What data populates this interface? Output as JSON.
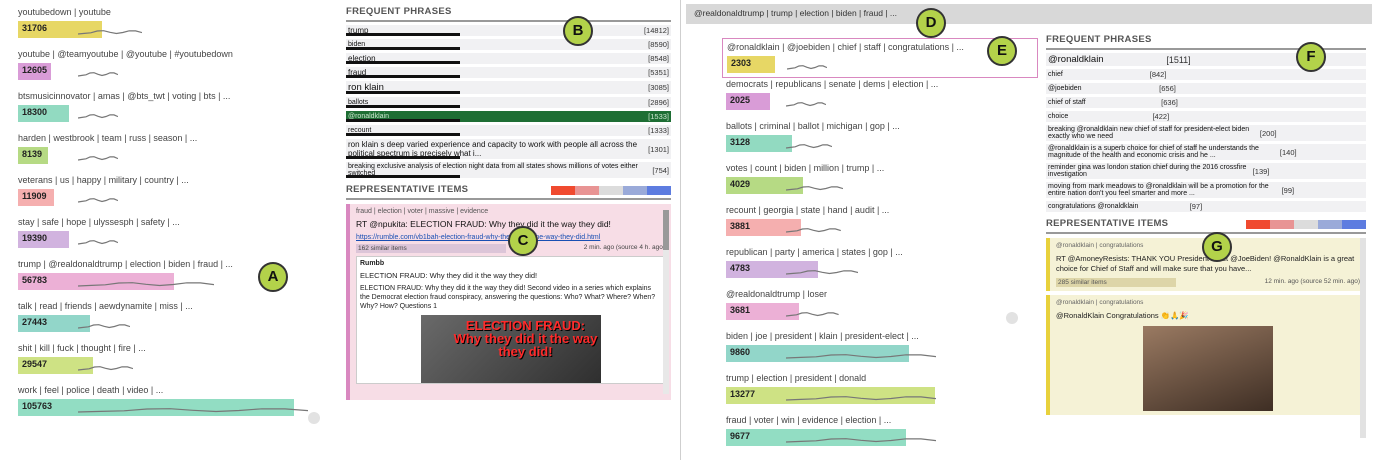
{
  "left_topics": [
    {
      "label": "youtubedown | youtube",
      "count": "31706",
      "color": "#e3d04a",
      "frac": 0.28,
      "spark": [
        0.82,
        1
      ]
    },
    {
      "label": "youtube | @teamyoutube | @youtube | #youtubedown",
      "count": "12605",
      "color": "#d28bd0",
      "frac": 0.11,
      "spark": [
        0.2,
        1
      ]
    },
    {
      "label": "btsmusicinnovator | amas | @bts_twt | voting | bts | ...",
      "count": "18300",
      "color": "#7fd3b6",
      "frac": 0.17,
      "spark": [
        0.3,
        1
      ]
    },
    {
      "label": "harden | westbrook | team | russ | season | ...",
      "count": "8139",
      "color": "#a9d46f",
      "frac": 0.08,
      "spark": [
        0.2,
        1
      ]
    },
    {
      "label": "veterans | us | happy | military | country | ...",
      "count": "11909",
      "color": "#f3a1a1",
      "frac": 0.12,
      "spark": [
        0.15,
        1
      ]
    },
    {
      "label": "stay | safe | hope | ulyssesph | safety | ...",
      "count": "19390",
      "color": "#c9a6d9",
      "frac": 0.17,
      "spark": [
        0.2,
        1
      ]
    },
    {
      "label": "trump | @realdonaldtrump | election | biden | fraud | ...",
      "count": "56783",
      "color": "#e9a2cf",
      "frac": 0.52,
      "spark": [
        0.4,
        1
      ]
    },
    {
      "label": "talk | read | friends | aewdynamite | miss | ...",
      "count": "27443",
      "color": "#7fcfc0",
      "frac": 0.24,
      "spark": [
        0.3,
        1
      ]
    },
    {
      "label": "shit | kill | fuck | thought | fire | ...",
      "count": "29547",
      "color": "#c5dd6e",
      "frac": 0.25,
      "spark": [
        0.75,
        1
      ]
    },
    {
      "label": "work | feel | police | death | video | ...",
      "count": "105763",
      "color": "#7fd7b9",
      "frac": 0.92,
      "spark": [
        0.3,
        1
      ]
    }
  ],
  "col_b": {
    "frequent_title": "FREQUENT PHRASES",
    "phrases": [
      {
        "text": "trump",
        "count": "[14812]",
        "size": "normal"
      },
      {
        "text": "biden",
        "count": "[8590]",
        "size": "small"
      },
      {
        "text": "election",
        "count": "[8548]",
        "size": "normal"
      },
      {
        "text": "fraud",
        "count": "[5351]",
        "size": "normal"
      },
      {
        "text": "ron klain",
        "count": "[3085]",
        "size": "big"
      },
      {
        "text": "ballots",
        "count": "[2896]",
        "size": "small"
      },
      {
        "text": "@ronaldklain",
        "count": "[1533]",
        "size": "small",
        "highlight": true
      },
      {
        "text": "recount",
        "count": "[1333]",
        "size": "small"
      },
      {
        "text": "ron klain s deep varied experience and capacity to work with people all across the political spectrum is precisely what i...",
        "count": "[1301]",
        "size": "normal"
      },
      {
        "text": "breaking exclusive analysis of election night data from all states shows millions of votes either switched",
        "count": "[754]",
        "size": "small"
      }
    ],
    "rep_title": "REPRESENTATIVE ITEMS",
    "item": {
      "tags": "fraud | election | voter | massive | evidence",
      "headline": "RT @npukita: ELECTION FRAUD: Why they did it the way they did!",
      "link": "https://rumble.com/vb1bah-election-fraud-why-they-did-it-the-way-they-did.html",
      "similar": "162 similar items",
      "time": "2 min. ago (source 4 h. ago)",
      "quote_author": "Rumbb",
      "quote_title": "ELECTION FRAUD: Why they did it the way they did!",
      "quote_body": "ELECTION FRAUD: Why they did it the way they did! Second video in a series which explains the Democrat election fraud conspiracy, answering the questions: Who? What? Where? When? Why? How? Questions 1",
      "thumb_text": "ELECTION FRAUD: Why they did it the way they did!"
    }
  },
  "right": {
    "breadcrumb": "@realdonaldtrump | trump | election | biden | fraud | ...",
    "topics": [
      {
        "label": "@ronaldklain | @joebiden | chief | staff | congratulations | ...",
        "count": "2303",
        "color": "#e3d04a",
        "frac": 0.22,
        "selected": true
      },
      {
        "label": "democrats | republicans | senate | dems | election | ...",
        "count": "2025",
        "color": "#d28bd0",
        "frac": 0.2
      },
      {
        "label": "ballots | criminal | ballot | michigan | gop | ...",
        "count": "3128",
        "color": "#7fd3b6",
        "frac": 0.3
      },
      {
        "label": "votes | count | biden | million | trump | ...",
        "count": "4029",
        "color": "#a9d46f",
        "frac": 0.35
      },
      {
        "label": "recount | georgia | state | hand | audit | ...",
        "count": "3881",
        "color": "#f3a1a1",
        "frac": 0.34
      },
      {
        "label": "republican | party | america | states | gop | ...",
        "count": "4783",
        "color": "#c9a6d9",
        "frac": 0.42
      },
      {
        "label": "@realdonaldtrump | loser",
        "count": "3681",
        "color": "#e9a2cf",
        "frac": 0.33
      },
      {
        "label": "biden | joe | president | klain | president-elect | ...",
        "count": "9860",
        "color": "#7fcfc0",
        "frac": 0.83
      },
      {
        "label": "trump | election | president | donald",
        "count": "13277",
        "color": "#c5dd6e",
        "frac": 0.95
      },
      {
        "label": "fraud | voter | win | evidence | election | ...",
        "count": "9677",
        "color": "#7fd7b9",
        "frac": 0.82
      }
    ],
    "frequent_title": "FREQUENT PHRASES",
    "phrases": [
      {
        "text": "@ronaldklain",
        "count": "[1511]",
        "size": "big"
      },
      {
        "text": "chief",
        "count": "[842]",
        "size": "small"
      },
      {
        "text": "@joebiden",
        "count": "[656]",
        "size": "small"
      },
      {
        "text": "chief of staff",
        "count": "[636]",
        "size": "small"
      },
      {
        "text": "choice",
        "count": "[422]",
        "size": "small"
      },
      {
        "text": "breaking @ronaldklain new chief of staff for president-elect biden exactly who we need",
        "count": "[200]",
        "size": "small"
      },
      {
        "text": "@ronaldklain is a superb choice for chief of staff he understands the magnitude of the health and economic crisis and he ...",
        "count": "[140]",
        "size": "small"
      },
      {
        "text": "reminder gina was london station chief during the 2016 crossfire investigation",
        "count": "[139]",
        "size": "small"
      },
      {
        "text": "moving from mark meadows to @ronaldklain will be a promotion for the entire nation don't you feel smarter and more ...",
        "count": "[99]",
        "size": "small"
      },
      {
        "text": "congratulations @ronaldklain",
        "count": "[97]",
        "size": "small"
      }
    ],
    "rep_title": "REPRESENTATIVE ITEMS",
    "items": [
      {
        "tags": "@ronaldklain | congratulations",
        "text": "RT @AmoneyResists: THANK YOU President-Elect @JoeBiden! @RonaldKlain is a great choice for Chief of Staff and will make sure that you have...",
        "similar": "285 similar items",
        "time": "12 min. ago (source 52 min. ago)"
      },
      {
        "tags": "@ronaldklain | congratulations",
        "text": "@RonaldKlain Congratulations 👏🙏🎉"
      }
    ]
  },
  "labels": [
    "A",
    "B",
    "C",
    "D",
    "E",
    "F",
    "G"
  ],
  "colors": {
    "left_strip": [
      "#f04a2f",
      "#e89494",
      "#dcdcdc",
      "#9aaad9",
      "#5d7ce0"
    ],
    "right_strip": [
      "#f04a2f",
      "#e89494",
      "#dcdcdc",
      "#9aaad9",
      "#5d7ce0"
    ],
    "highlight_phrase": "#1e6e34",
    "circle_label": "#b3d24a"
  }
}
